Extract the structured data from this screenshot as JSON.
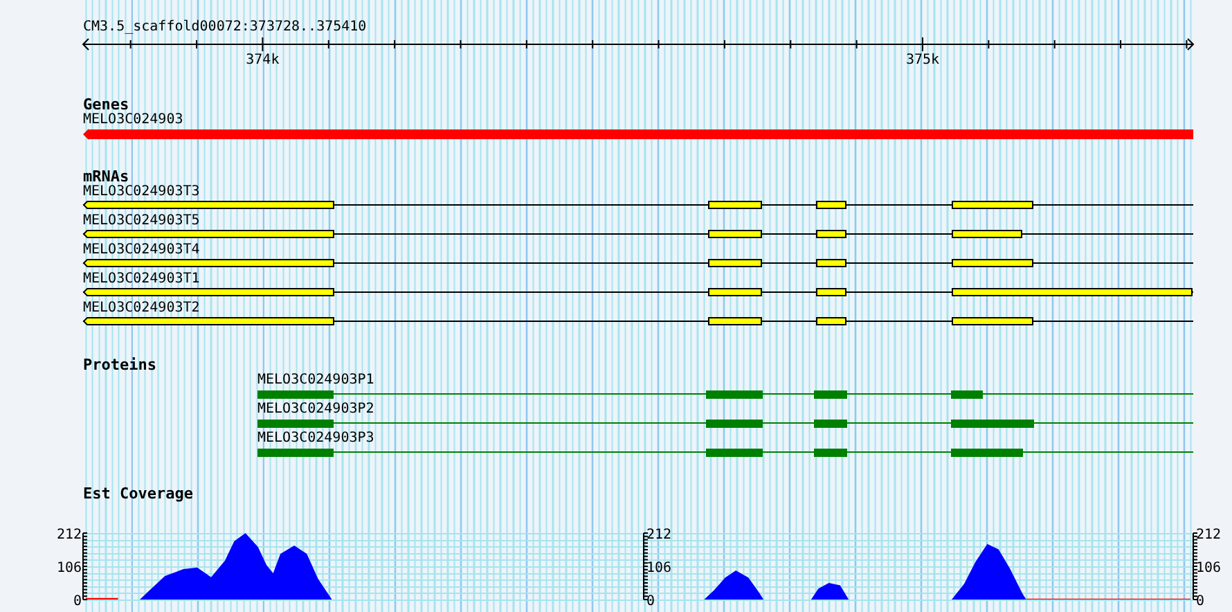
{
  "ruler": {
    "title": "CM3.5_scaffold00072:373728..375410",
    "ticks": [
      {
        "label": "374k"
      },
      {
        "label": "375k"
      }
    ]
  },
  "tracks": [
    {
      "kind": "gene",
      "title": "Genes",
      "features": [
        {
          "name": "MELO3C024903"
        }
      ]
    },
    {
      "kind": "mrna",
      "title": "mRNAs",
      "features": [
        {
          "name": "MELO3C024903T3"
        },
        {
          "name": "MELO3C024903T5"
        },
        {
          "name": "MELO3C024903T4"
        },
        {
          "name": "MELO3C024903T1"
        },
        {
          "name": "MELO3C024903T2"
        }
      ]
    },
    {
      "kind": "protein",
      "title": "Proteins",
      "features": [
        {
          "name": "MELO3C024903P1"
        },
        {
          "name": "MELO3C024903P2"
        },
        {
          "name": "MELO3C024903P3"
        }
      ]
    },
    {
      "kind": "coverage",
      "title": "Est Coverage",
      "scales": [
        {
          "ticks": [
            "212",
            "106",
            "0"
          ]
        },
        {
          "ticks": [
            "212",
            "106",
            "0"
          ]
        },
        {
          "ticks": [
            "212",
            "106",
            "0"
          ]
        }
      ]
    }
  ]
}
